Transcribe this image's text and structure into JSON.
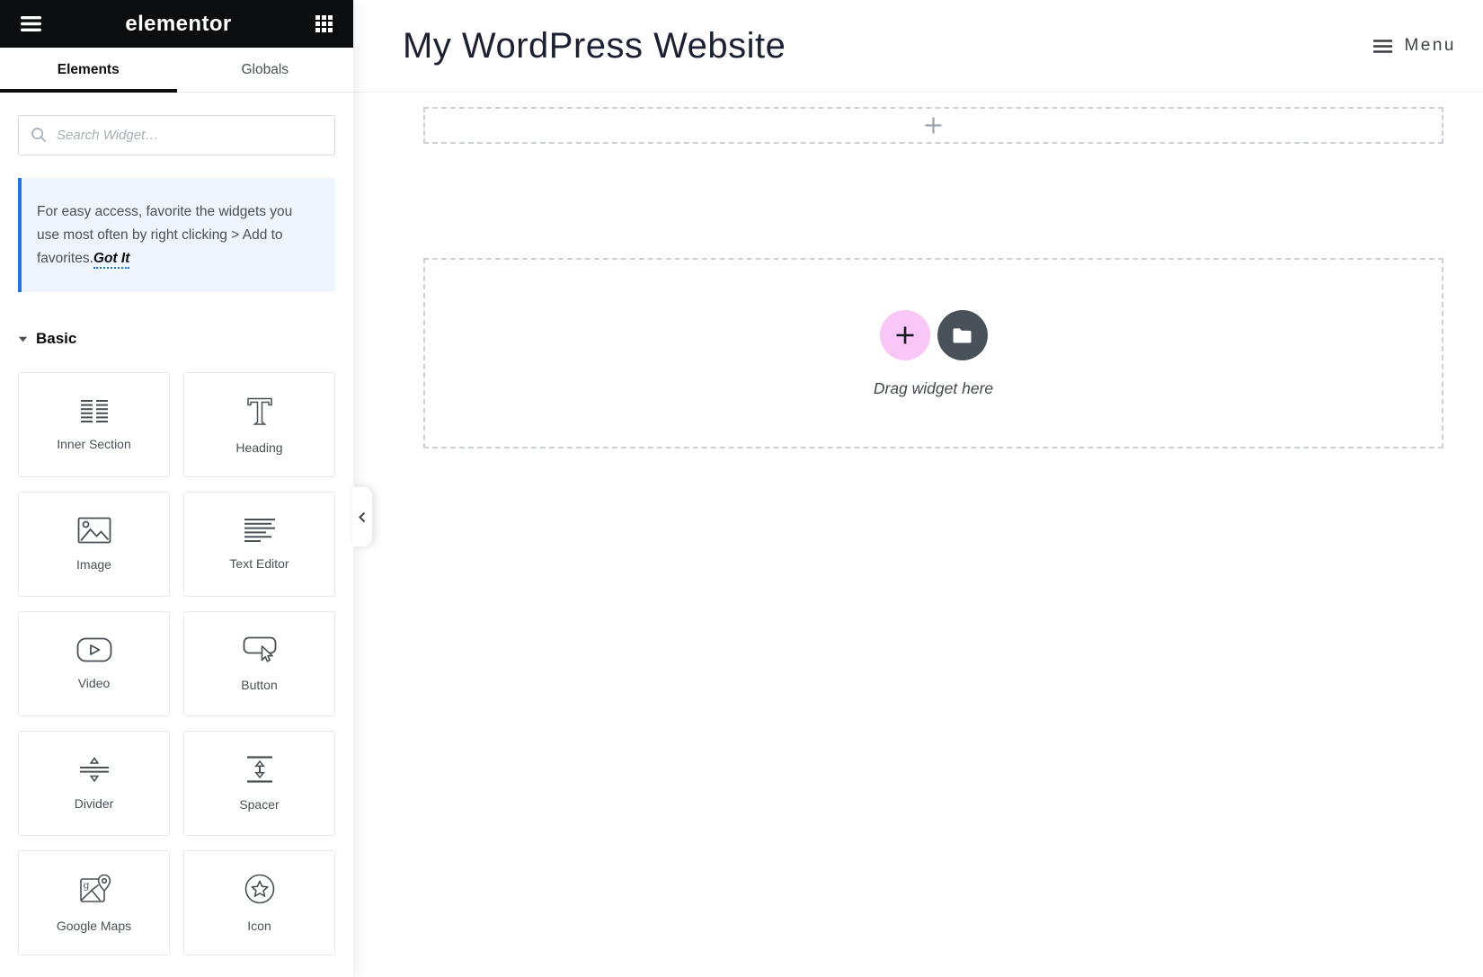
{
  "sidebar": {
    "logo_text": "elementor",
    "tabs": [
      {
        "label": "Elements",
        "active": true
      },
      {
        "label": "Globals",
        "active": false
      }
    ],
    "search_placeholder": "Search Widget…",
    "notice_text": "For easy access, favorite the widgets you use most often by right clicking > Add to favorites.",
    "notice_action": "Got It",
    "category_title": "Basic",
    "widgets": [
      {
        "label": "Inner Section",
        "icon": "inner-section-icon"
      },
      {
        "label": "Heading",
        "icon": "heading-icon"
      },
      {
        "label": "Image",
        "icon": "image-icon"
      },
      {
        "label": "Text Editor",
        "icon": "text-editor-icon"
      },
      {
        "label": "Video",
        "icon": "video-icon"
      },
      {
        "label": "Button",
        "icon": "button-icon"
      },
      {
        "label": "Divider",
        "icon": "divider-icon"
      },
      {
        "label": "Spacer",
        "icon": "spacer-icon"
      },
      {
        "label": "Google Maps",
        "icon": "google-maps-icon"
      },
      {
        "label": "Icon",
        "icon": "icon-icon"
      }
    ]
  },
  "canvas": {
    "site_title": "My WordPress Website",
    "menu_label": "Menu",
    "drag_text": "Drag widget here"
  },
  "colors": {
    "topbar_black": "#0c0d0e",
    "accent_blue": "#2173e2",
    "add_section_pink": "#f8c7f7",
    "folder_button_gray": "#49525b",
    "widget_icon_gray": "#495157",
    "dashed_border": "#ccd1d8"
  }
}
